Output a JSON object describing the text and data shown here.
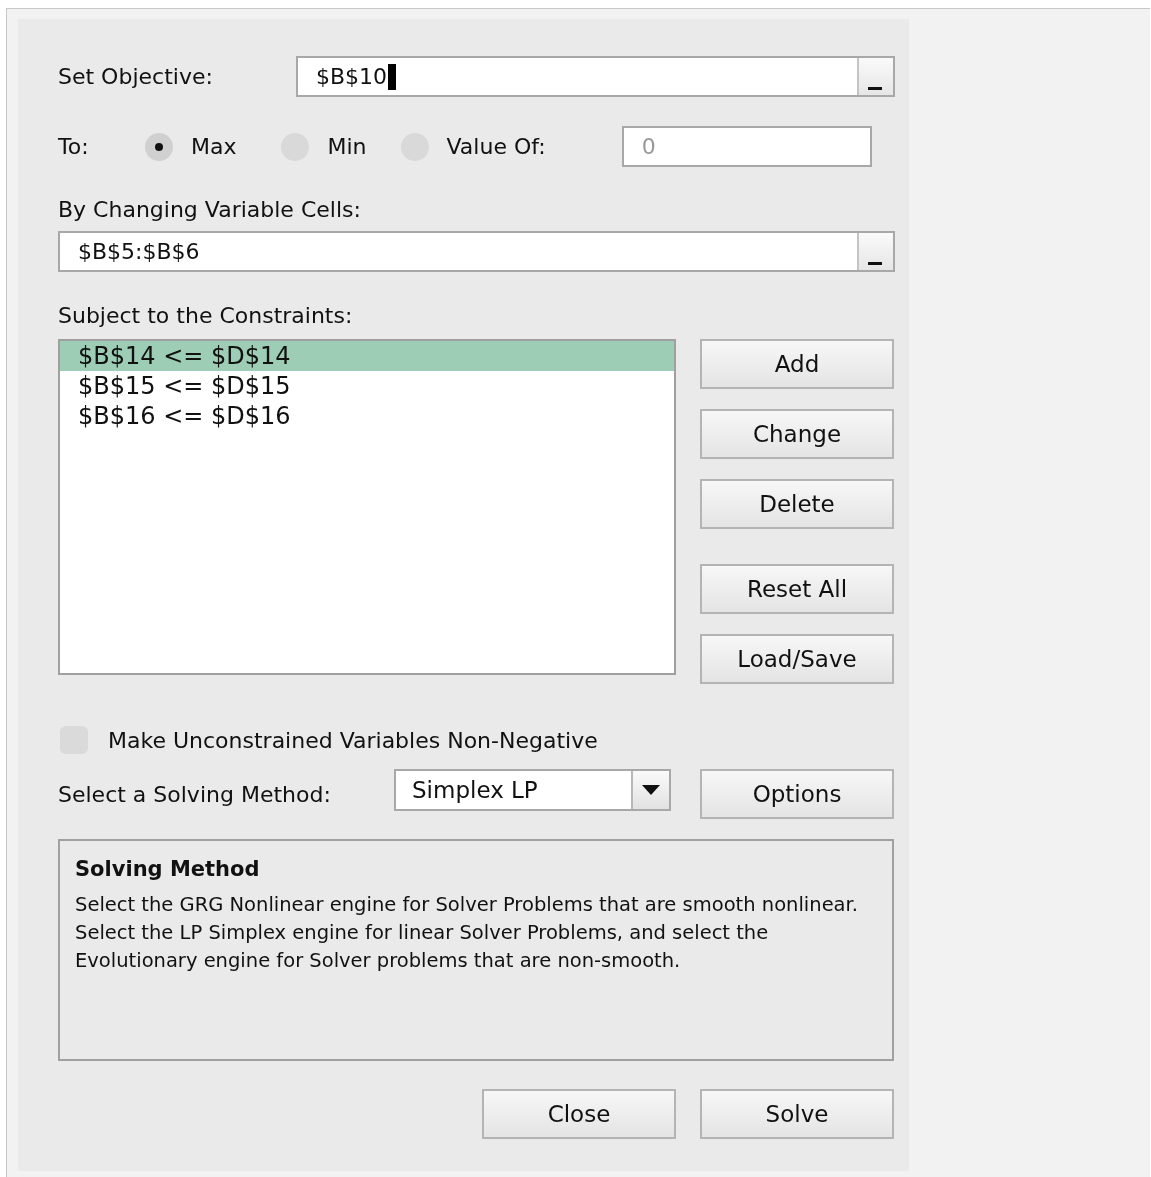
{
  "objective": {
    "label": "Set Objective:",
    "value": "$B$10",
    "focused": true
  },
  "to": {
    "label": "To:",
    "options": [
      {
        "label": "Max",
        "selected": true
      },
      {
        "label": "Min",
        "selected": false
      },
      {
        "label": "Value Of:",
        "selected": false
      }
    ],
    "value_of": {
      "value": "0",
      "disabled": true
    }
  },
  "variable_cells": {
    "label": "By Changing Variable Cells:",
    "value": "$B$5:$B$6"
  },
  "constraints": {
    "label": "Subject to the Constraints:",
    "items": [
      {
        "text": "$B$14 <= $D$14",
        "selected": true
      },
      {
        "text": "$B$15 <= $D$15",
        "selected": false
      },
      {
        "text": "$B$16 <= $D$16",
        "selected": false
      }
    ]
  },
  "constraint_buttons": [
    "Add",
    "Change",
    "Delete",
    "Reset All",
    "Load/Save"
  ],
  "non_negative": {
    "label": "Make Unconstrained Variables Non-Negative",
    "checked": false
  },
  "method": {
    "label": "Select a Solving Method:",
    "value": "Simplex LP",
    "options_button": "Options"
  },
  "info": {
    "title": "Solving Method",
    "text": "Select the GRG Nonlinear engine for Solver Problems that are smooth nonlinear. Select the LP Simplex engine for linear Solver Problems, and select the Evolutionary engine for Solver problems that are non-smooth."
  },
  "footer_buttons": [
    "Close",
    "Solve"
  ]
}
